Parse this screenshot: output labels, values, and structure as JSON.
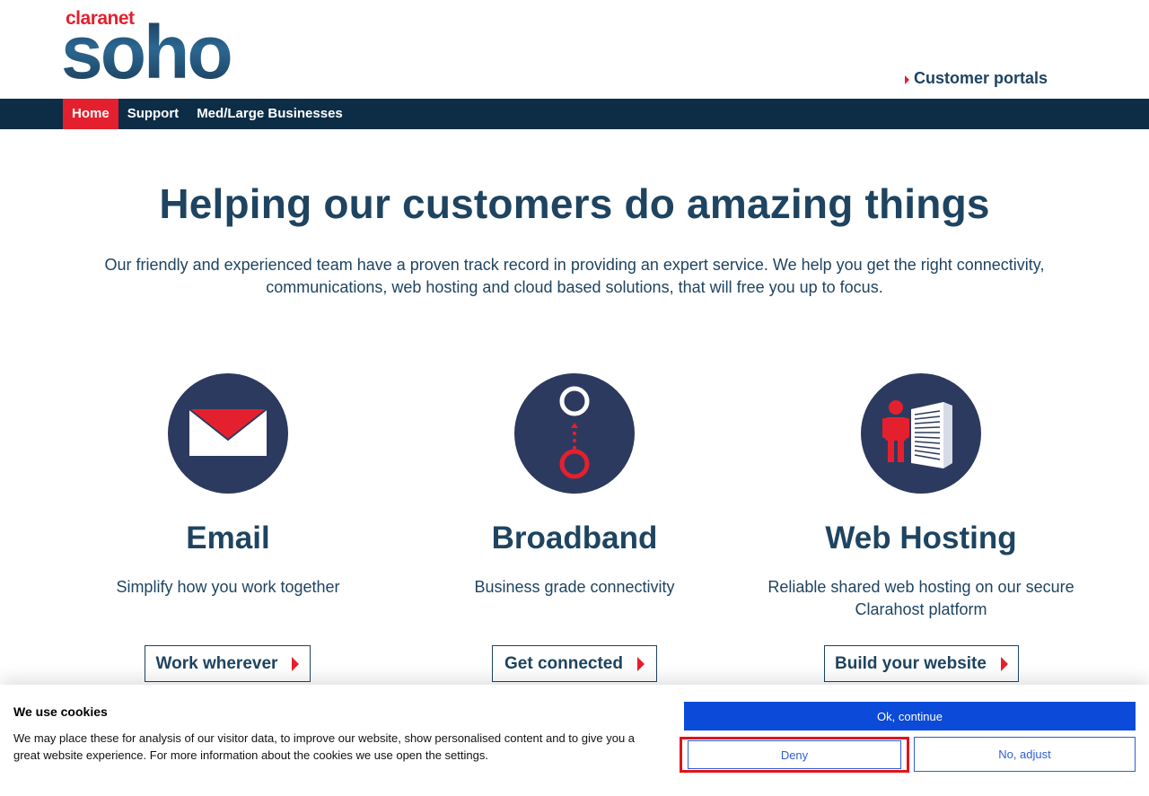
{
  "header": {
    "logo_brand": "claranet",
    "logo_name": "soho",
    "portals_label": "Customer portals"
  },
  "nav": {
    "items": [
      {
        "label": "Home",
        "active": true
      },
      {
        "label": "Support",
        "active": false
      },
      {
        "label": "Med/Large Businesses",
        "active": false
      }
    ]
  },
  "hero": {
    "title": "Helping our customers do amazing things",
    "text": "Our friendly and experienced team have a proven track record in providing an expert service. We help you get the right connectivity, communications, web hosting and cloud based solutions, that will free you up to focus."
  },
  "services": [
    {
      "title": "Email",
      "subtitle": "Simplify how you work together",
      "button": "Work wherever",
      "icon": "envelope-icon"
    },
    {
      "title": "Broadband",
      "subtitle": "Business grade connectivity",
      "button": "Get connected",
      "icon": "connection-icon"
    },
    {
      "title": "Web Hosting",
      "subtitle": "Reliable shared web hosting on our secure Clarahost platform",
      "button": "Build your website",
      "icon": "server-icon"
    }
  ],
  "cookie": {
    "title": "We use cookies",
    "text": "We may place these for analysis of our visitor data, to improve our website, show personalised content and to give you a great website experience. For more information about the cookies we use open the settings.",
    "ok_label": "Ok, continue",
    "deny_label": "Deny",
    "adjust_label": "No, adjust"
  },
  "colors": {
    "brand_navy": "#1e4461",
    "nav_bg": "#0d2d47",
    "accent_red": "#e5202e",
    "icon_circle": "#2d3a5f",
    "cookie_blue": "#0c4ad9"
  }
}
